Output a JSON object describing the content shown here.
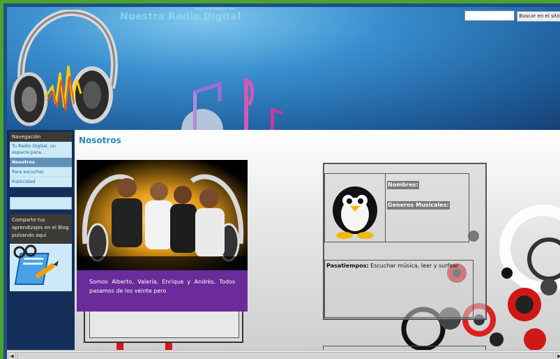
{
  "header": {
    "site_title": "Nuestra Radio Digital",
    "site_url": "nuestraradiodigital.com",
    "search_placeholder": "",
    "search_button": "Buscar en el sitio"
  },
  "sidebar": {
    "nav_title": "Navegación",
    "items": [
      {
        "label": "Tu Radio Digital, un espacio para..."
      },
      {
        "label": "Nosotros"
      },
      {
        "label": "Para escuchar"
      },
      {
        "label": "Publicidad"
      }
    ],
    "blog_text": "Comparte tus aprendizajes en el Blog pulsando aquí"
  },
  "main": {
    "page_title": "Nosotros",
    "caption": "Somos Alberto, Valeria, Enrique y Andrés. Todos pasamos de los veinte pero",
    "profile": {
      "names_label": "Nombres:",
      "genres_label": "Generos Musicales:",
      "hobbies_label": "Pasatiempos:",
      "hobbies_value": " Escuchar música, leer y surfear"
    }
  },
  "colors": {
    "accent": "#2a8ab8",
    "caption_bg": "#6b2b9a",
    "frame": "#4aa32e"
  }
}
